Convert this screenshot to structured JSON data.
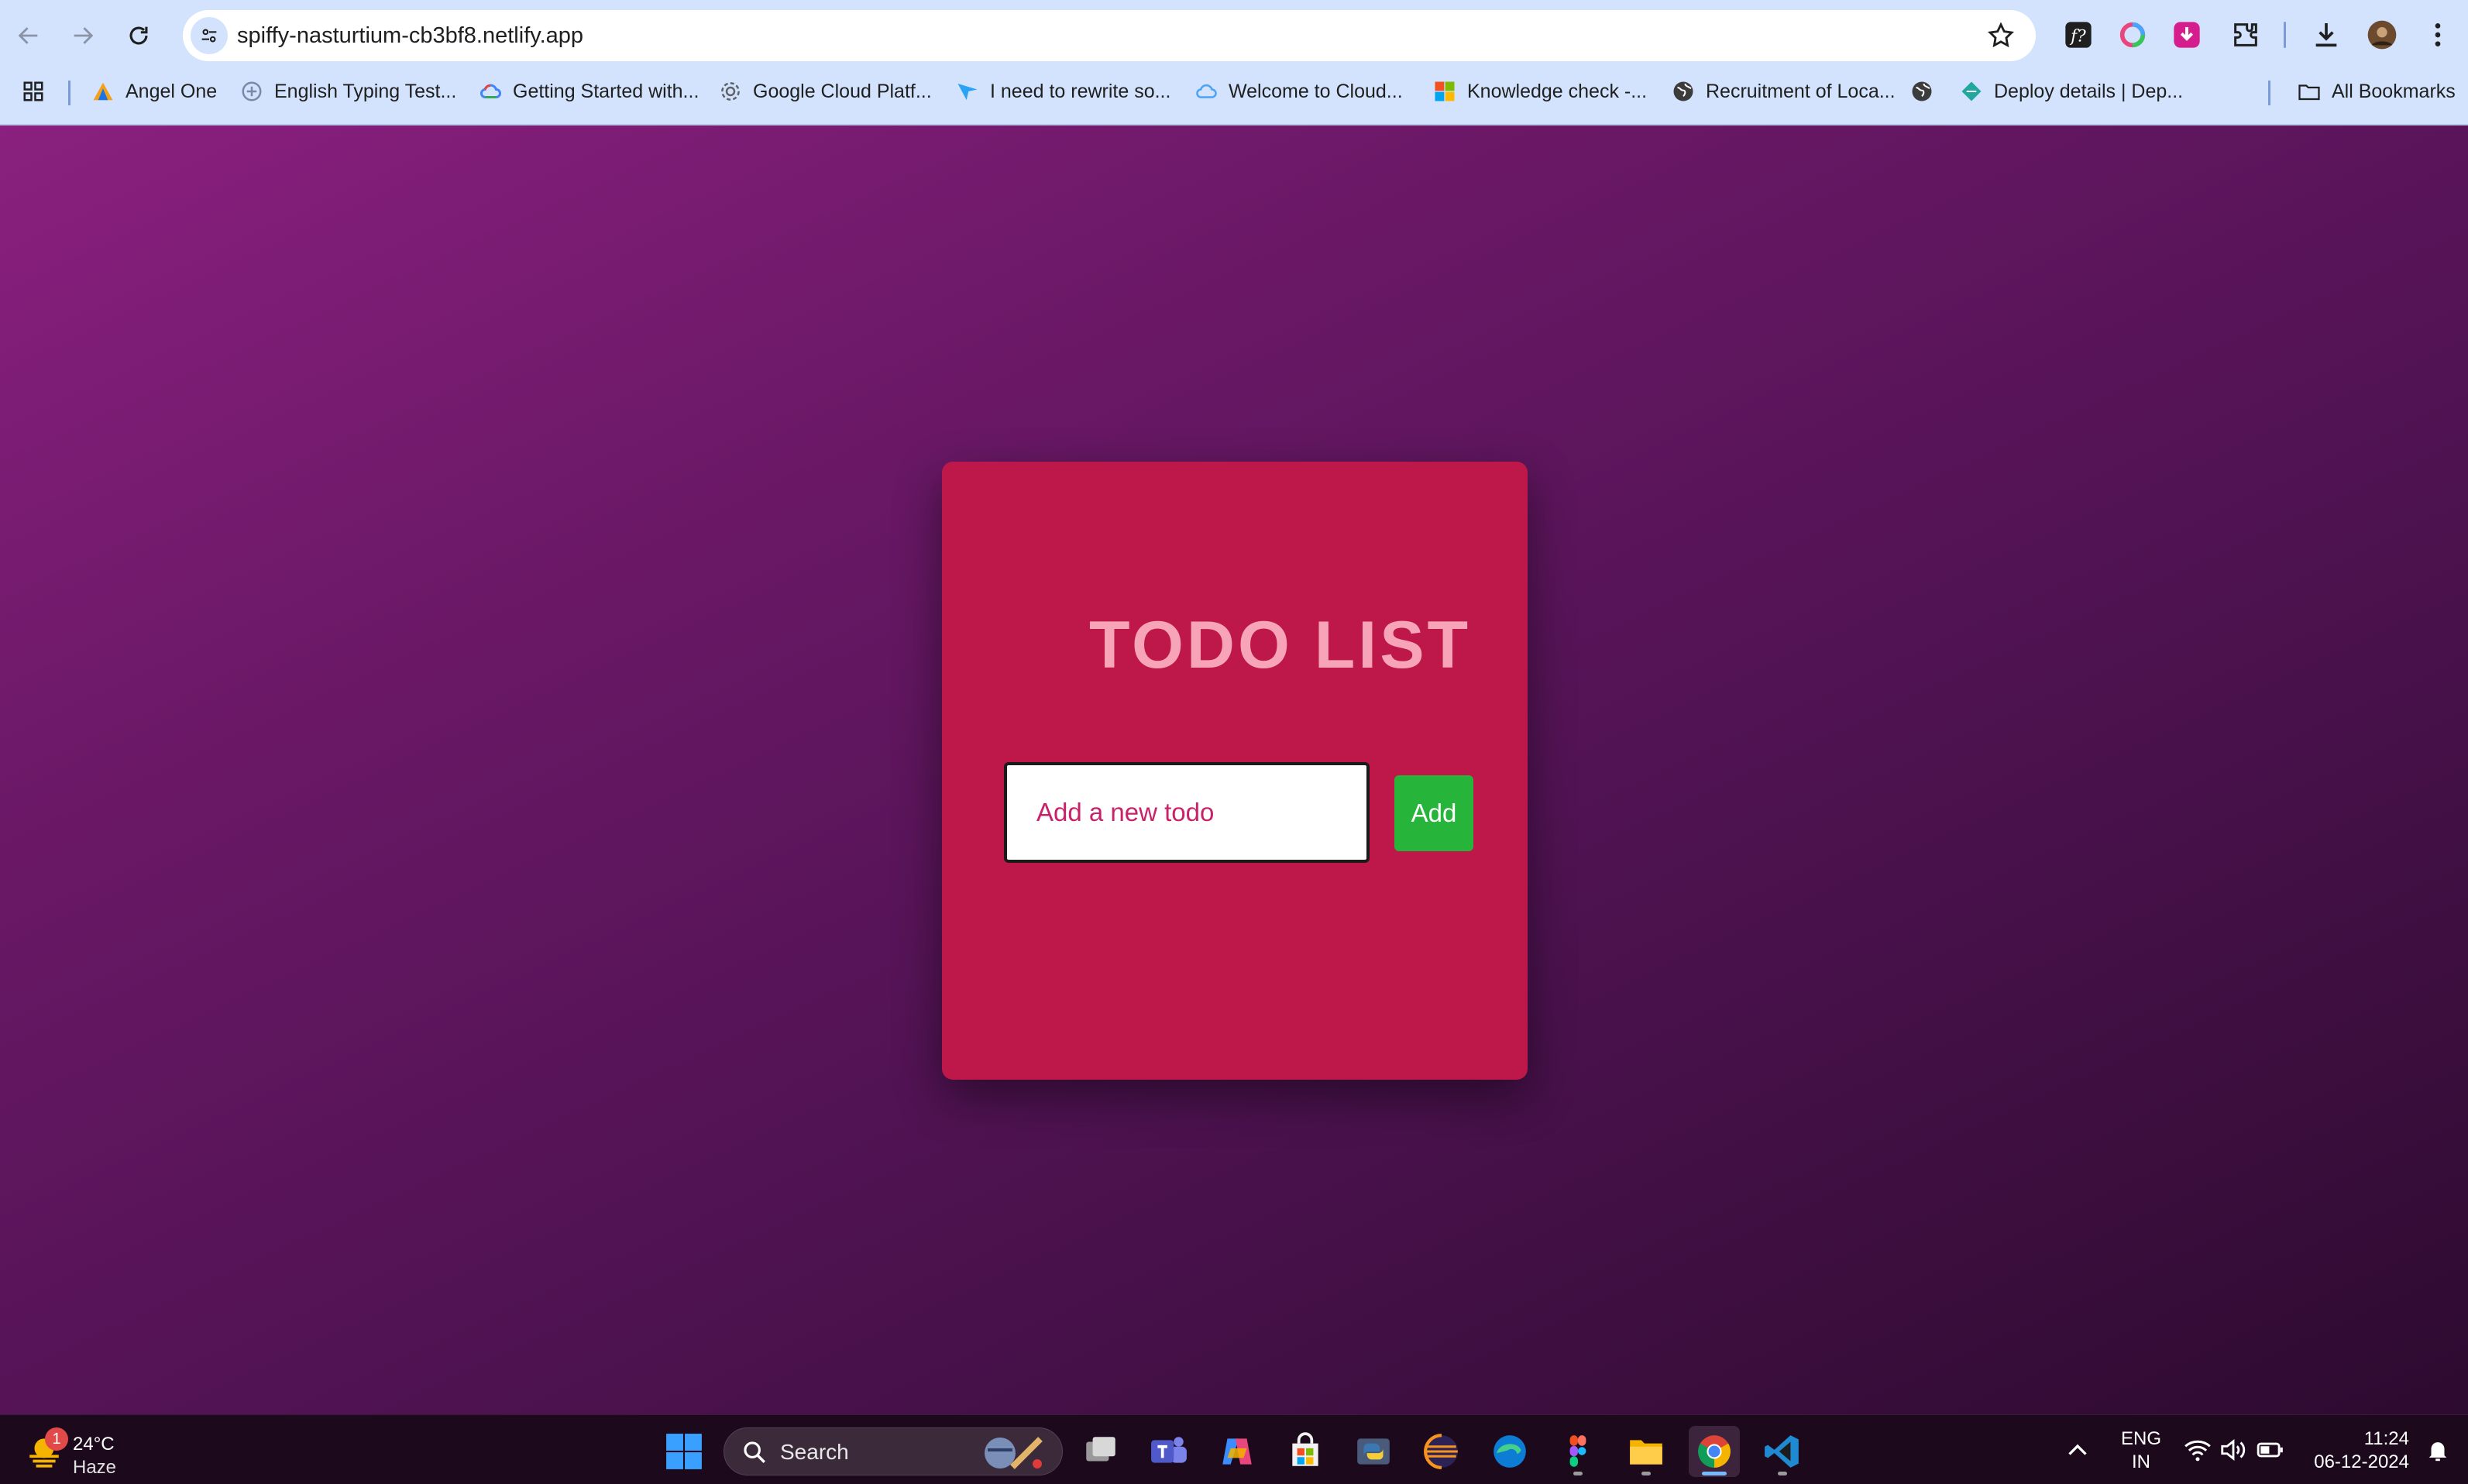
{
  "browser": {
    "url": "spiffy-nasturtium-cb3bf8.netlify.app",
    "bookmarks": [
      {
        "label": "Angel One",
        "icon": "angel-one-icon"
      },
      {
        "label": "English Typing Test...",
        "icon": "typing-test-icon"
      },
      {
        "label": "Getting Started with...",
        "icon": "google-cloud-icon"
      },
      {
        "label": "Google Cloud Platf...",
        "icon": "gear-icon"
      },
      {
        "label": "I need to rewrite so...",
        "icon": "paper-plane-icon"
      },
      {
        "label": "Welcome to Cloud...",
        "icon": "cloud-icon"
      },
      {
        "label": "Knowledge check -...",
        "icon": "microsoft-icon"
      },
      {
        "label": "Recruitment of Loca...",
        "icon": "globe-icon"
      },
      {
        "label": "",
        "icon": "globe-icon"
      },
      {
        "label": "Deploy details | Dep...",
        "icon": "netlify-icon"
      }
    ],
    "all_bookmarks_label": "All Bookmarks"
  },
  "app": {
    "title": "TODO LIST",
    "input_placeholder": "Add a new todo",
    "add_button_label": "Add",
    "colors": {
      "card": "#bd1849",
      "title": "#f7a4b8",
      "button": "#27b43a",
      "placeholder": "#c8226a"
    }
  },
  "taskbar": {
    "weather_temp": "24°C",
    "weather_desc": "Haze",
    "weather_badge": "1",
    "search_label": "Search",
    "lang_line1": "ENG",
    "lang_line2": "IN",
    "time": "11:24",
    "date": "06-12-2024"
  }
}
